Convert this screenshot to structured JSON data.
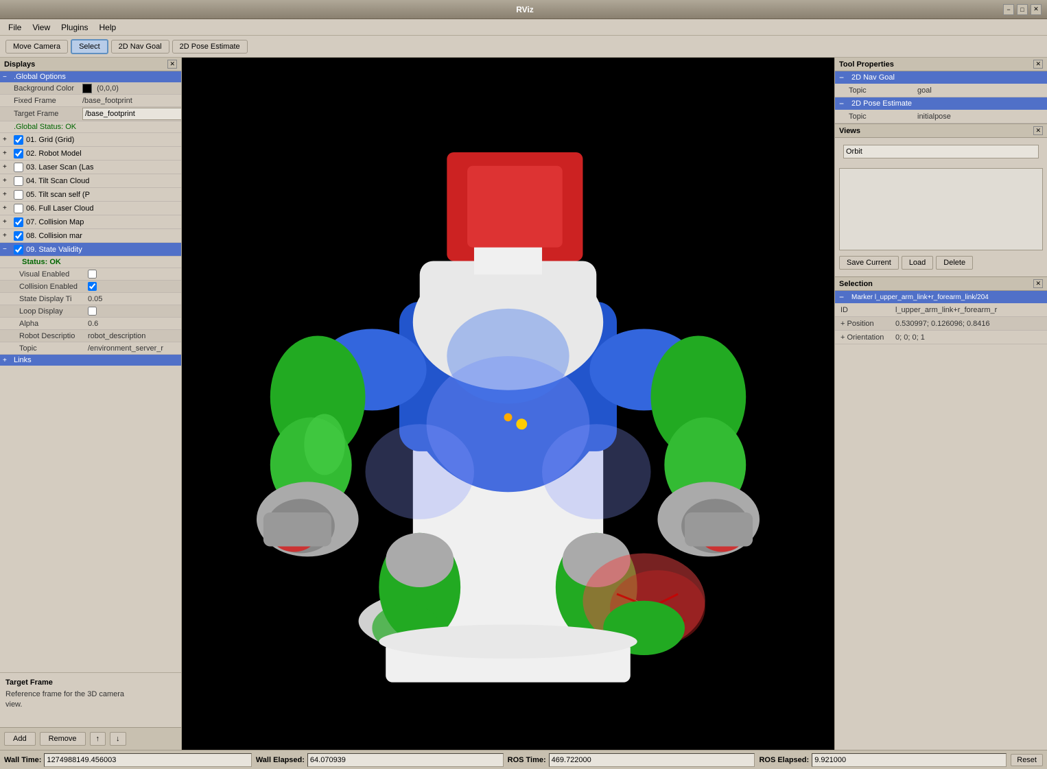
{
  "titlebar": {
    "title": "RViz",
    "min": "−",
    "max": "□",
    "close": "✕"
  },
  "menubar": {
    "items": [
      "File",
      "View",
      "Plugins",
      "Help"
    ]
  },
  "toolbar": {
    "buttons": [
      "Move Camera",
      "Select",
      "2D Nav Goal",
      "2D Pose Estimate"
    ],
    "active": "Select"
  },
  "displays": {
    "title": "Displays",
    "global_options": ".Global Options",
    "background_color_label": "Background Color",
    "background_color_value": "(0,0,0)",
    "fixed_frame_label": "Fixed Frame",
    "fixed_frame_value": "/base_footprint",
    "target_frame_label": "Target Frame",
    "target_frame_value": "/base_footprint",
    "global_status": ".Global Status: OK",
    "items": [
      {
        "id": "01",
        "label": "01. Grid (Grid)",
        "checked": true,
        "selected": false,
        "expanded": false
      },
      {
        "id": "02",
        "label": "02. Robot Model",
        "checked": true,
        "selected": false,
        "expanded": false
      },
      {
        "id": "03",
        "label": "03. Laser Scan (Las",
        "checked": false,
        "selected": false,
        "expanded": false
      },
      {
        "id": "04",
        "label": "04. Tilt Scan Cloud",
        "checked": false,
        "selected": false,
        "expanded": false
      },
      {
        "id": "05",
        "label": "05. Tilt scan self (P",
        "checked": false,
        "selected": false,
        "expanded": false
      },
      {
        "id": "06",
        "label": "06. Full Laser Cloud",
        "checked": false,
        "selected": false,
        "expanded": false
      },
      {
        "id": "07",
        "label": "07. Collision Map",
        "checked": true,
        "selected": false,
        "expanded": false
      },
      {
        "id": "08",
        "label": "08. Collision mar",
        "checked": true,
        "selected": false,
        "expanded": false
      },
      {
        "id": "09",
        "label": "09. State Validity",
        "checked": true,
        "selected": true,
        "expanded": true
      }
    ],
    "state_validity": {
      "status": "Status: OK",
      "visual_enabled_label": "Visual Enabled",
      "visual_enabled": false,
      "collision_enabled_label": "Collision Enabled",
      "collision_enabled": true,
      "state_display_label": "State Display Ti",
      "state_display_value": "0.05",
      "loop_display_label": "Loop Display",
      "loop_display": false,
      "alpha_label": "Alpha",
      "alpha_value": "0.6",
      "robot_desc_label": "Robot Descriptio",
      "robot_desc_value": "robot_description",
      "topic_label": "Topic",
      "topic_value": "/environment_server_r"
    },
    "links_label": "Links",
    "description_title": "Target Frame",
    "description_text": "Reference frame for the 3D camera\nview.",
    "add_btn": "Add",
    "remove_btn": "Remove"
  },
  "tool_properties": {
    "title": "Tool Properties",
    "nav_goal_label": "2D Nav Goal",
    "topic_label1": "Topic",
    "topic_value1": "goal",
    "pose_estimate_label": "2D Pose Estimate",
    "topic_label2": "Topic",
    "topic_value2": "initialpose"
  },
  "views": {
    "title": "Views",
    "type": "Orbit",
    "save_current": "Save Current",
    "load": "Load",
    "delete": "Delete"
  },
  "selection": {
    "title": "Selection",
    "marker_label": "Marker l_upper_arm_link+r_forearm_link/204",
    "id_label": "ID",
    "id_value": "l_upper_arm_link+r_forearm_r",
    "position_label": "Position",
    "position_value": "0.530997; 0.126096; 0.8416",
    "orientation_label": "Orientation",
    "orientation_value": "0; 0; 0; 1"
  },
  "statusbar": {
    "wall_time_label": "Wall Time:",
    "wall_time_value": "1274988149.456003",
    "wall_elapsed_label": "Wall Elapsed:",
    "wall_elapsed_value": "64.070939",
    "ros_time_label": "ROS Time:",
    "ros_time_value": "469.722000",
    "ros_elapsed_label": "ROS Elapsed:",
    "ros_elapsed_value": "9.921000",
    "reset_btn": "Reset"
  }
}
